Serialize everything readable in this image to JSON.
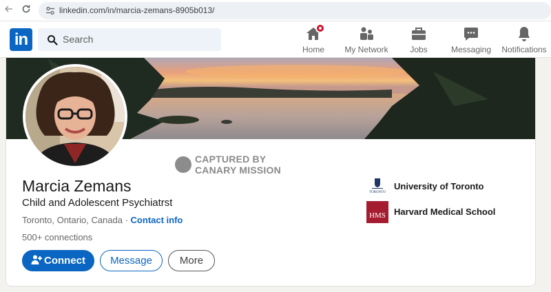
{
  "browser": {
    "url": "linkedin.com/in/marcia-zemans-8905b013/"
  },
  "header": {
    "logo_text": "in",
    "search_placeholder": "Search",
    "nav": [
      {
        "label": "Home",
        "icon": "home-icon"
      },
      {
        "label": "My Network",
        "icon": "network-icon"
      },
      {
        "label": "Jobs",
        "icon": "briefcase-icon"
      },
      {
        "label": "Messaging",
        "icon": "messaging-icon"
      },
      {
        "label": "Notifications",
        "icon": "bell-icon"
      }
    ],
    "accent": "#0a66c2",
    "notification_badge_color": "#cb112d"
  },
  "profile": {
    "name": "Marcia Zemans",
    "headline": "Child and Adolescent Psychiatrst",
    "location": "Toronto, Ontario, Canada",
    "separator": " · ",
    "contact_link": "Contact info",
    "connections": "500+ connections",
    "buttons": {
      "connect": "Connect",
      "message": "Message",
      "more": "More"
    },
    "education": [
      {
        "name": "University of Toronto",
        "logo_text": "TORONTO"
      },
      {
        "name": "Harvard Medical School",
        "logo_text": "HMS"
      }
    ]
  },
  "watermark": {
    "line1": "CAPTURED BY",
    "line2": "CANARY MISSION"
  }
}
